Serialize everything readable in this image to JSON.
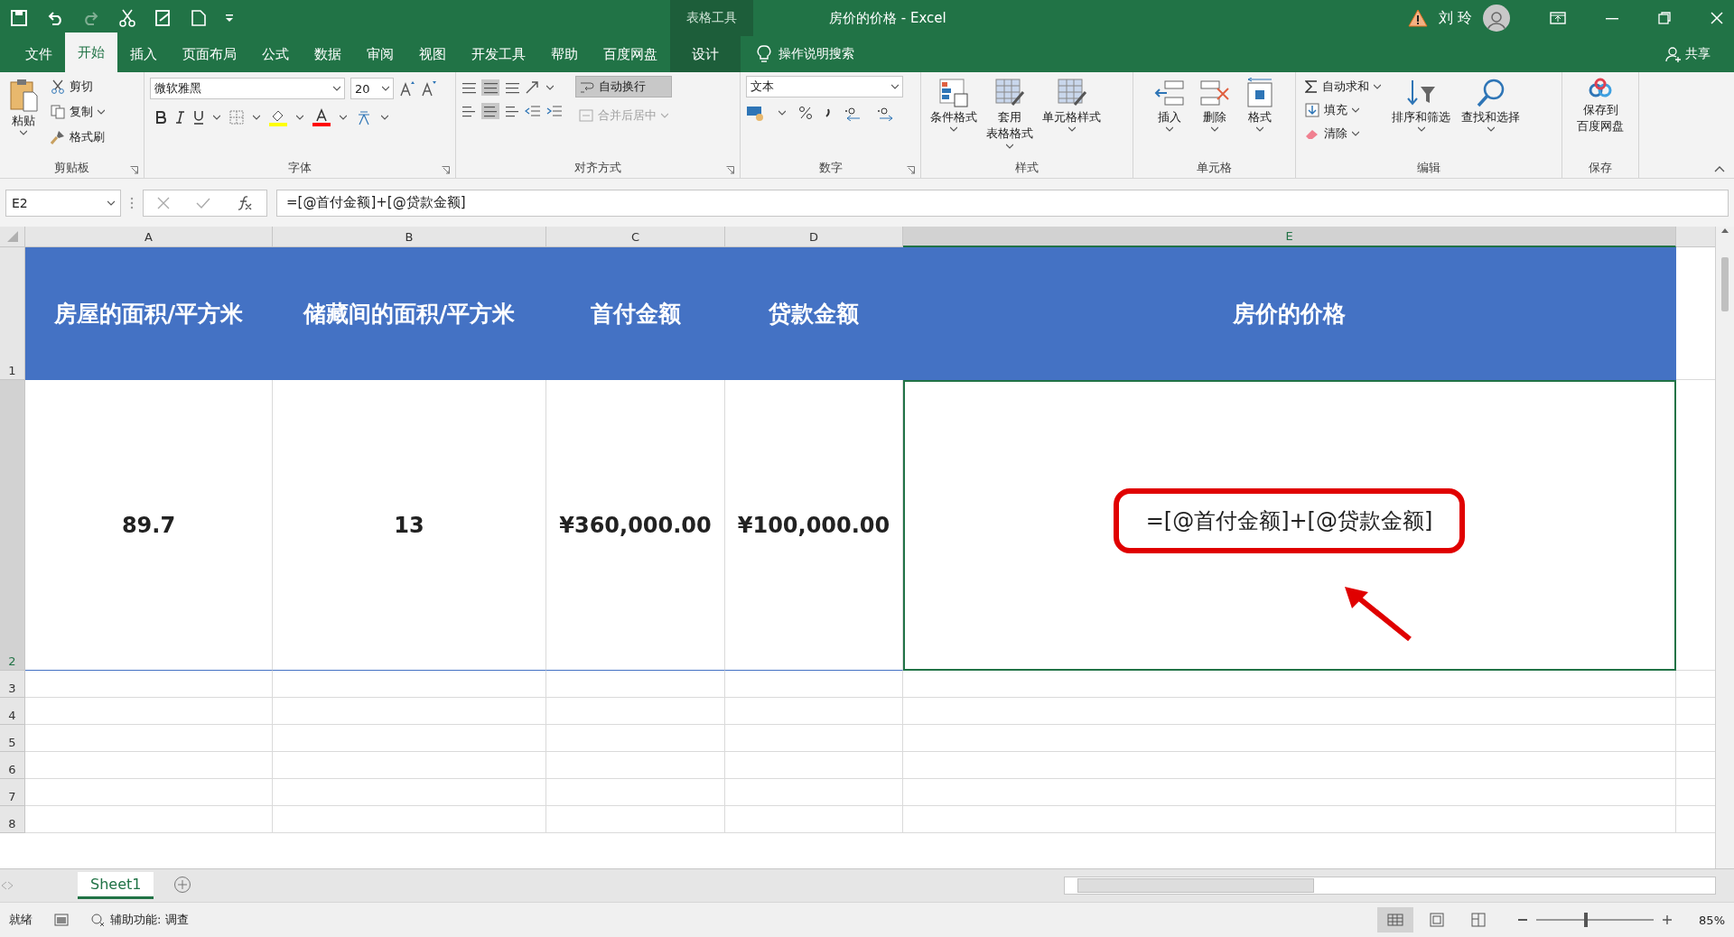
{
  "title_bar": {
    "context_label": "表格工具",
    "title": "房价的价格  -  Excel",
    "user": "刘 玲"
  },
  "ribbon_tabs": [
    {
      "label": "文件",
      "selected": false
    },
    {
      "label": "开始",
      "selected": true
    },
    {
      "label": "插入",
      "selected": false
    },
    {
      "label": "页面布局",
      "selected": false
    },
    {
      "label": "公式",
      "selected": false
    },
    {
      "label": "数据",
      "selected": false
    },
    {
      "label": "审阅",
      "selected": false
    },
    {
      "label": "视图",
      "selected": false
    },
    {
      "label": "开发工具",
      "selected": false
    },
    {
      "label": "帮助",
      "selected": false
    },
    {
      "label": "百度网盘",
      "selected": false
    },
    {
      "label": "设计",
      "selected": false
    }
  ],
  "tell_me": "操作说明搜索",
  "share": "共享",
  "ribbon": {
    "clipboard": {
      "paste": "粘贴",
      "cut": "剪切",
      "copy": "复制",
      "painter": "格式刷",
      "label": "剪贴板"
    },
    "font": {
      "font_name": "微软雅黑",
      "font_size": "20",
      "label": "字体"
    },
    "alignment": {
      "wrap": "自动换行",
      "merge": "合并后居中",
      "merge_disabled": true,
      "label": "对齐方式"
    },
    "number": {
      "format": "文本",
      "label": "数字"
    },
    "styles": {
      "items": [
        [
          "条件格式"
        ],
        [
          "套用",
          "表格格式"
        ],
        [
          "单元格样式"
        ]
      ],
      "label": "样式"
    },
    "cells": {
      "items": [
        "插入",
        "删除",
        "格式"
      ],
      "label": "单元格"
    },
    "editing": {
      "autosum": "自动求和",
      "fill": "填充",
      "clear": "清除",
      "sort": "排序和筛选",
      "find": "查找和选择",
      "label": "编辑"
    },
    "save": {
      "lines": [
        "保存到",
        "百度网盘"
      ],
      "label": "保存"
    }
  },
  "formula_bar": {
    "name_box": "E2",
    "formula": "=[@首付金额]+[@贷款金额]"
  },
  "sheet": {
    "columns": [
      {
        "label": "A",
        "selected": false
      },
      {
        "label": "B",
        "selected": false
      },
      {
        "label": "C",
        "selected": false
      },
      {
        "label": "D",
        "selected": false
      },
      {
        "label": "E",
        "selected": true
      }
    ],
    "rows": [
      {
        "number": "1",
        "selected": false,
        "kind": "header",
        "cells": [
          "房屋的面积/平方米",
          "储藏间的面积/平方米",
          "首付金额",
          "贷款金额",
          "房价的价格"
        ]
      },
      {
        "number": "2",
        "selected": true,
        "kind": "data",
        "cells": [
          "89.7",
          "13",
          "¥360,000.00",
          "¥100,000.00",
          "=[@首付金额]+[@贷款金额]"
        ],
        "selected_cells": [
          false,
          false,
          false,
          false,
          true
        ]
      },
      {
        "number": "3",
        "selected": false,
        "kind": "empty",
        "cells": []
      },
      {
        "number": "4",
        "selected": false,
        "kind": "empty",
        "cells": []
      },
      {
        "number": "5",
        "selected": false,
        "kind": "empty",
        "cells": []
      },
      {
        "number": "6",
        "selected": false,
        "kind": "empty",
        "cells": []
      },
      {
        "number": "7",
        "selected": false,
        "kind": "empty",
        "cells": []
      },
      {
        "number": "8",
        "selected": false,
        "kind": "empty",
        "cells": []
      }
    ],
    "annotation": {
      "highlight_box": true,
      "arrow": true
    }
  },
  "sheet_tabs": [
    {
      "label": "Sheet1",
      "selected": true
    }
  ],
  "status_bar": {
    "status": "就绪",
    "accessibility": "辅助功能: 调查",
    "views": [
      {
        "kind": "normal",
        "selected": true
      },
      {
        "kind": "page_layout",
        "selected": false
      },
      {
        "kind": "page_break",
        "selected": false
      }
    ],
    "zoom": "85%",
    "zoom_level": {
      "level": 0.42
    }
  }
}
